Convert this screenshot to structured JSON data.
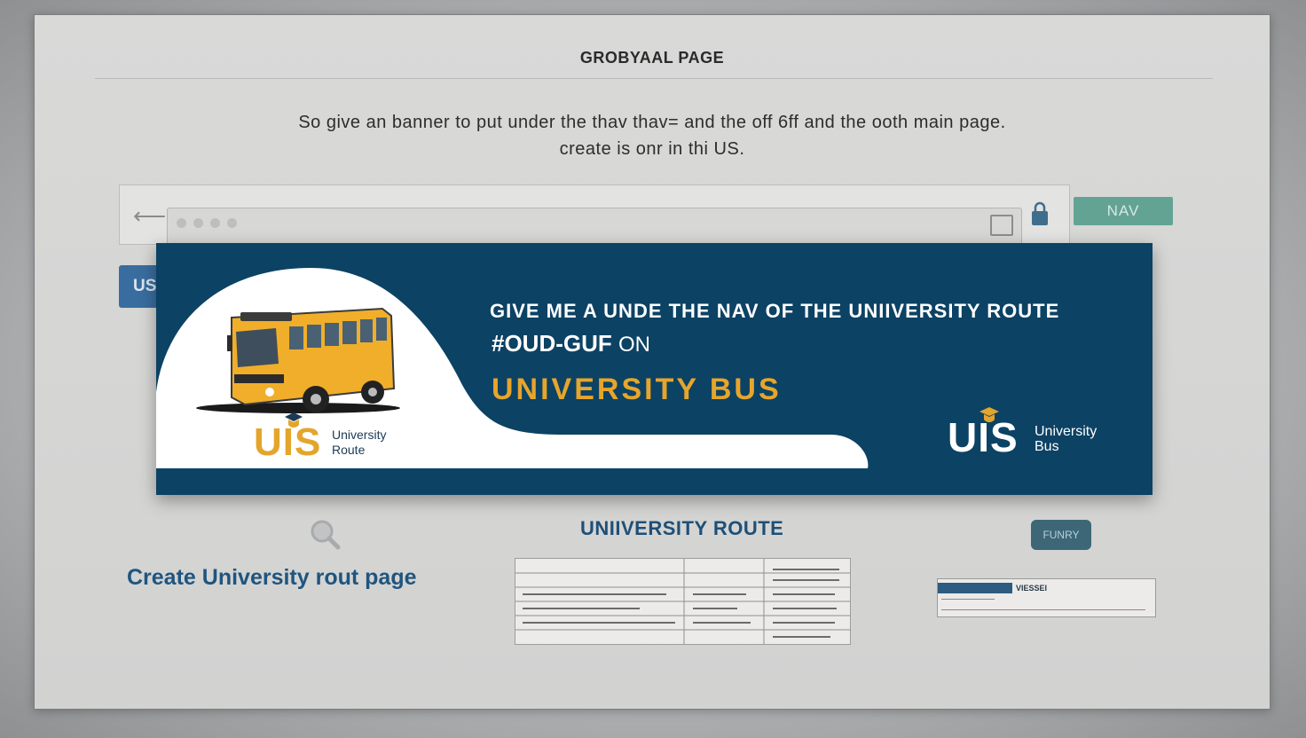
{
  "page": {
    "title": "GROBYAAL PAGE",
    "prompt_line_1": "So give an banner to put under the thav thav= and the off 6ff and the ooth main page.",
    "prompt_line_2": "create is onr in thi US."
  },
  "browser": {
    "nav_tag": "NAV",
    "us_tab": "US"
  },
  "banner": {
    "headline_1": "GIVE ME A UNDE THE NAV OF THE UNIIVERSITY ROUTE",
    "headline_2": "#OUD-GUF",
    "headline_2_suffix": "ON",
    "headline_3": "UNIVERSITY BUS",
    "logo_left_text": "UIS",
    "logo_left_line1": "University",
    "logo_left_line2": "Route",
    "logo_right_text": "UIS",
    "logo_right_line1": "University",
    "logo_right_line2": "Bus",
    "colors": {
      "background": "#0c4264",
      "accent": "#e7a52b",
      "white_panel": "#ffffff"
    }
  },
  "content": {
    "create_text": "Create University rout page",
    "route_heading": "UNIIVERSITY ROUTE",
    "small_button": "FUNRY",
    "mini_panel_label": "VIESSEI"
  },
  "icons": {
    "back": "back-arrow-icon",
    "bookmark": "bookmark-icon",
    "lock": "lock-icon",
    "search": "search-icon"
  }
}
